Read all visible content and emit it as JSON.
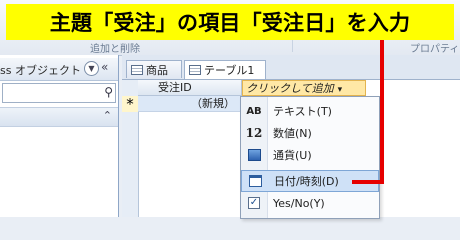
{
  "caption": "主題「受注」の項目「受注日」を入力",
  "ribbon": {
    "group_left": "追加と削除",
    "group_right": "プロパティ"
  },
  "nav": {
    "title": "ss オブジェクト"
  },
  "tabs": [
    {
      "label": "商品"
    },
    {
      "label": "テーブル1"
    }
  ],
  "grid": {
    "col_id": "受注ID",
    "col_add": "クリックして追加",
    "new_row_label": "（新規）"
  },
  "menu": {
    "items": [
      {
        "icon": "AB",
        "label": "テキスト(T)"
      },
      {
        "icon": "12",
        "label": "数値(N)"
      },
      {
        "icon": "currency-icon",
        "label": "通貨(U)"
      },
      {
        "icon": "calendar-icon",
        "label": "日付/時刻(D)",
        "highlighted": true
      },
      {
        "icon": "checkbox-icon",
        "label": "Yes/No(Y)"
      }
    ]
  },
  "colors": {
    "caption_bg": "#ffff00",
    "pointer": "#e60000",
    "menu_highlight": "#cfe1f7"
  }
}
